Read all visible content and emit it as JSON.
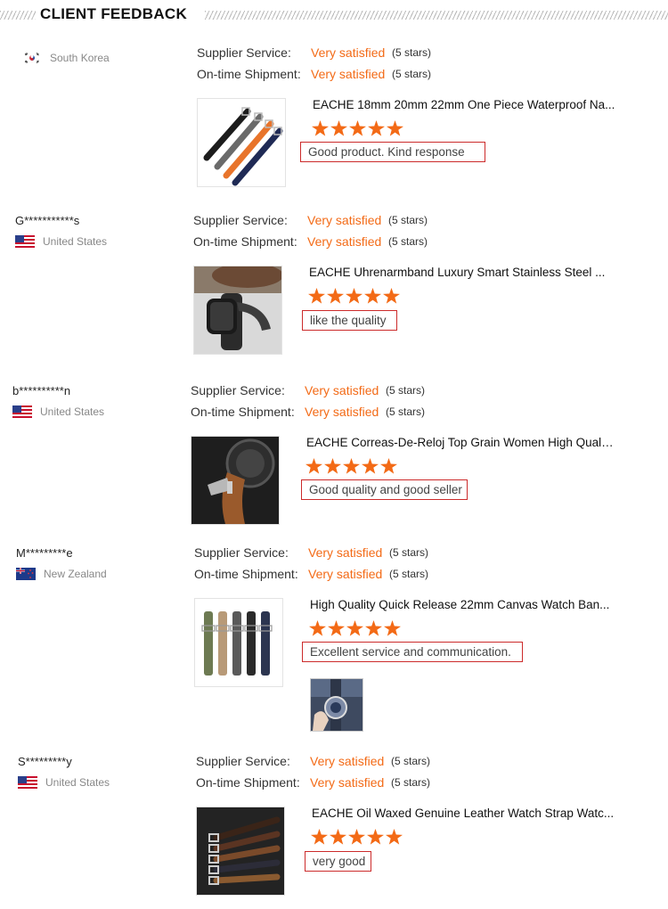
{
  "header": {
    "title": "CLIENT FEEDBACK"
  },
  "labels": {
    "supplier_service": "Supplier Service:",
    "ontime_shipment": "On-time Shipment:"
  },
  "colors": {
    "accent": "#f36a16",
    "comment_border": "#cc2b2b"
  },
  "reviews": [
    {
      "user": "",
      "country": "South Korea",
      "flag": "south-korea-flag",
      "supplier_service": {
        "value": "Very satisfied",
        "stars": "(5 stars)"
      },
      "ontime_shipment": {
        "value": "Very satisfied",
        "stars": "(5 stars)"
      },
      "product_title": "EACHE 18mm 20mm 22mm One Piece Waterproof Na...",
      "rating": 5,
      "comment": "Good product. Kind response",
      "product_icon": "nylon-strap-set-image"
    },
    {
      "user": "G***********s",
      "country": "United States",
      "flag": "united-states-flag",
      "supplier_service": {
        "value": "Very satisfied",
        "stars": "(5 stars)"
      },
      "ontime_shipment": {
        "value": "Very satisfied",
        "stars": "(5 stars)"
      },
      "product_title": "EACHE Uhrenarmband Luxury Smart Stainless Steel ...",
      "rating": 5,
      "comment": "like the quality",
      "product_icon": "smartwatch-mesh-band-image"
    },
    {
      "user": "b**********n",
      "country": "United States",
      "flag": "united-states-flag",
      "supplier_service": {
        "value": "Very satisfied",
        "stars": "(5 stars)"
      },
      "ontime_shipment": {
        "value": "Very satisfied",
        "stars": "(5 stars)"
      },
      "product_title": "EACHE Correas-De-Reloj Top Grain Women High Quali...",
      "rating": 5,
      "comment": "Good quality and good seller",
      "product_icon": "leather-strap-watch-image"
    },
    {
      "user": "M*********e",
      "country": "New Zealand",
      "flag": "new-zealand-flag",
      "supplier_service": {
        "value": "Very satisfied",
        "stars": "(5 stars)"
      },
      "ontime_shipment": {
        "value": "Very satisfied",
        "stars": "(5 stars)"
      },
      "product_title": "High Quality Quick Release 22mm Canvas Watch Ban...",
      "rating": 5,
      "comment": "Excellent service and communication.",
      "product_icon": "canvas-strap-set-image",
      "buyer_photo": "buyer-watch-photo"
    },
    {
      "user": "S*********y",
      "country": "United States",
      "flag": "united-states-flag",
      "supplier_service": {
        "value": "Very satisfied",
        "stars": "(5 stars)"
      },
      "ontime_shipment": {
        "value": "Very satisfied",
        "stars": "(5 stars)"
      },
      "product_title": "EACHE Oil Waxed Genuine Leather Watch Strap Watc...",
      "rating": 5,
      "comment": "very good",
      "product_icon": "oil-waxed-leather-straps-image"
    }
  ]
}
